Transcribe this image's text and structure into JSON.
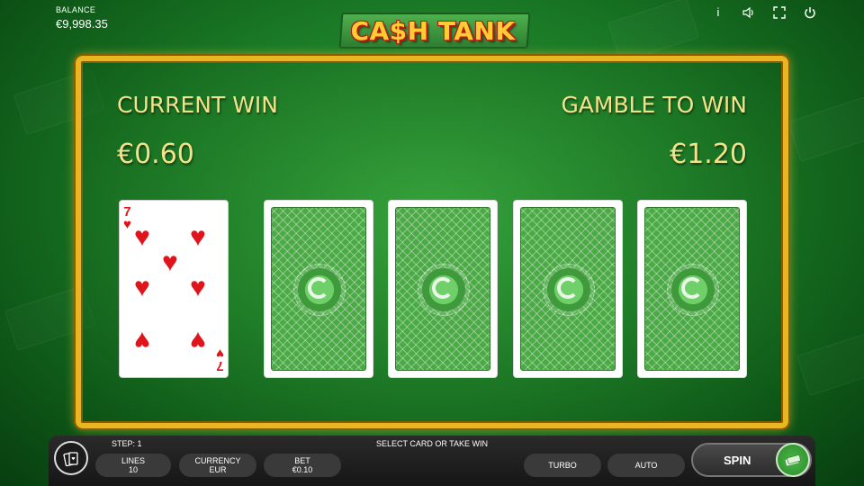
{
  "header": {
    "balance_label": "BALANCE",
    "balance_value": "€9,998.35",
    "logo_text": "CA$H TANK",
    "icons": [
      "info-icon",
      "sound-icon",
      "fullscreen-icon",
      "power-icon"
    ]
  },
  "gamble": {
    "current_win_label": "CURRENT WIN",
    "current_win_value": "€0.60",
    "gamble_to_win_label": "GAMBLE TO WIN",
    "gamble_to_win_value": "€1.20",
    "dealer_card": {
      "rank": "7",
      "suit": "hearts"
    },
    "card_backs": 4
  },
  "footer": {
    "step": "STEP: 1",
    "message": "SELECT CARD OR TAKE WIN",
    "lines_label": "LINES",
    "lines_value": "10",
    "currency_label": "CURRENCY",
    "currency_value": "EUR",
    "bet_label": "BET",
    "bet_value": "€0.10",
    "turbo_label": "TURBO",
    "auto_label": "AUTO",
    "spin_label": "SPIN"
  },
  "colors": {
    "accent_gold": "#e9b622",
    "text_gold": "#f2e38a",
    "felt_green": "#1a7a26",
    "heart_red": "#e0141b"
  }
}
